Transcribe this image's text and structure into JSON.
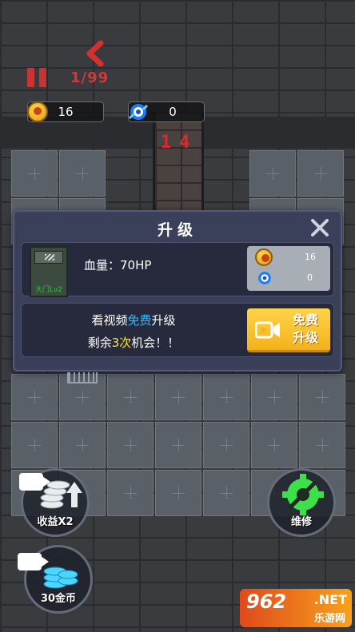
{
  "hud": {
    "wave": "1/99",
    "coins": "16",
    "gems": "0",
    "countdown": "14"
  },
  "dialog": {
    "title": "升级",
    "gate_label": "大门Lv2",
    "hp_text": "血量：70HP",
    "cost": {
      "coins": "16",
      "gems": "0"
    },
    "video_line1_pre": "看视频",
    "video_line1_hl": "免费",
    "video_line1_post": "升级",
    "video_line2_pre": "剩余",
    "video_line2_hl": "3次",
    "video_line2_post": "机会！！",
    "free_button_line1": "免费",
    "free_button_line2": "升级"
  },
  "buttons": {
    "income_x2": "收益X2",
    "coins_30": "30金币",
    "repair": "维修"
  },
  "watermark": {
    "main": "962",
    "net": ".NET",
    "sub": "乐游网"
  },
  "colors": {
    "wave_red": "#cc3a3a",
    "highlight_blue": "#36b6ff",
    "highlight_yellow": "#ffe43a",
    "free_button": "#f2b21c",
    "repair_green": "#3ee04a"
  }
}
